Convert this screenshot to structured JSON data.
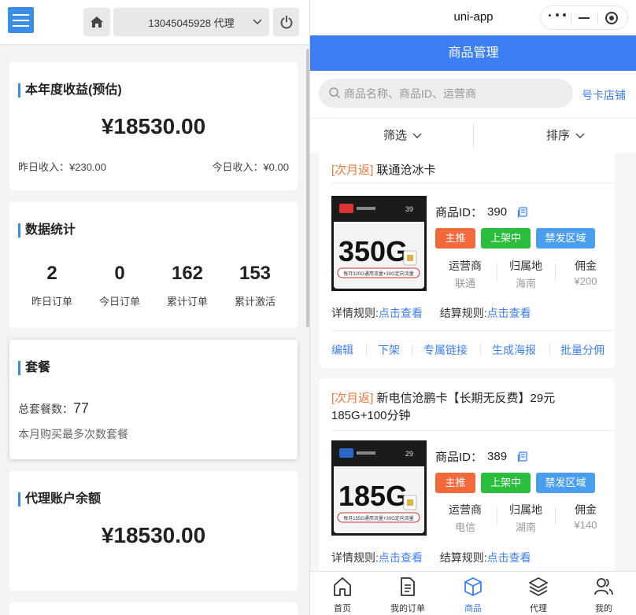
{
  "left": {
    "account": "13045045928 代理",
    "annual_card": {
      "title": "本年度收益(预估)",
      "amount": "¥18530.00",
      "yesterday": "昨日收入：¥230.00",
      "today": "今日收入：¥0.00"
    },
    "stats_card": {
      "title": "数据统计",
      "items": [
        {
          "value": "2",
          "label": "昨日订单"
        },
        {
          "value": "0",
          "label": "今日订单"
        },
        {
          "value": "162",
          "label": "累计订单"
        },
        {
          "value": "153",
          "label": "累计激活"
        }
      ]
    },
    "package_card": {
      "title": "套餐",
      "total_label": "总套餐数：",
      "total_value": "77",
      "note": "本月购买最多次数套餐"
    },
    "balance_card": {
      "title": "代理账户余额",
      "amount": "¥18530.00"
    }
  },
  "right": {
    "sys_title": "uni-app",
    "nav_title": "商品管理",
    "search_placeholder": "商品名称、商品ID、运营商",
    "shop_link": "号卡店铺",
    "filter_label": "筛选",
    "sort_label": "排序",
    "products": [
      {
        "tag": "[次月返]",
        "name": "联通沧冰卡",
        "id_label": "商品ID：",
        "id": "390",
        "badges": [
          "主推",
          "上架中",
          "禁发区域"
        ],
        "operator_key": "运营商",
        "operator": "联通",
        "region_key": "归属地",
        "region": "海南",
        "commission_key": "佣金",
        "commission": "¥200",
        "detail_rule": "详情规则:",
        "detail_link": "点击查看",
        "settle_rule": "结算规则:",
        "settle_link": "点击查看",
        "actions": [
          "编辑",
          "下架",
          "专属链接",
          "生成海报",
          "批量分佣"
        ],
        "image": {
          "data_amount": "350G",
          "price": "39",
          "caption": "每月320G通用流量+30G定向流量"
        }
      },
      {
        "tag": "[次月返]",
        "name": "新电信沧鹏卡【长期无反费】29元185G+100分钟",
        "id_label": "商品ID：",
        "id": "389",
        "badges": [
          "主推",
          "上架中",
          "禁发区域"
        ],
        "operator_key": "运营商",
        "operator": "电信",
        "region_key": "归属地",
        "region": "湖南",
        "commission_key": "佣金",
        "commission": "¥140",
        "detail_rule": "详情规则:",
        "detail_link": "点击查看",
        "settle_rule": "结算规则:",
        "settle_link": "点击查看",
        "image": {
          "data_amount": "185G",
          "price": "29",
          "caption": "每月155G通用流量+30G定向流量"
        }
      }
    ],
    "tabs": [
      "首页",
      "我的订单",
      "商品",
      "代理",
      "我的"
    ],
    "active_tab": "商品",
    "colors": {
      "primary": "#3c7ff5",
      "badge_main": "#f26a3c",
      "badge_online": "#2bbd3c",
      "badge_region": "#4a9ef0",
      "tag": "#ee7a3c"
    }
  }
}
